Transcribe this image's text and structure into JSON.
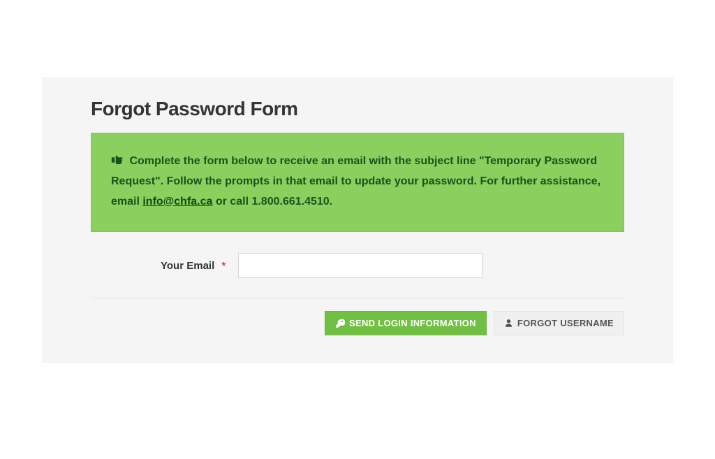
{
  "page": {
    "title": "Forgot Password Form"
  },
  "alert": {
    "text_before_link": "Complete the form below to receive an email with the subject line \"Temporary Password Request\". Follow the prompts in that email to update your password. For further assistance, email ",
    "link_text": "info@chfa.ca",
    "text_after_link": " or call 1.800.661.4510."
  },
  "form": {
    "email_label": "Your Email",
    "required_mark": "*",
    "email_value": ""
  },
  "buttons": {
    "send_label": "SEND LOGIN INFORMATION",
    "forgot_username_label": "FORGOT USERNAME"
  }
}
